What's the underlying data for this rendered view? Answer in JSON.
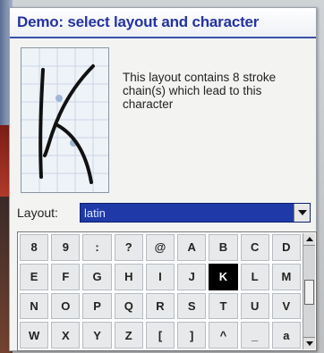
{
  "dialog": {
    "title": "Demo: select layout and character"
  },
  "preview": {
    "icon": "handwritten-character-preview",
    "character": "K"
  },
  "description": "This layout contains 8 stroke chain(s) which lead to this character",
  "layout": {
    "label": "Layout:",
    "value": "latin"
  },
  "grid": {
    "selected_character": "K",
    "rows": [
      [
        "8",
        "9",
        ":",
        "?",
        "@",
        "A",
        "B",
        "C",
        "D"
      ],
      [
        "E",
        "F",
        "G",
        "H",
        "I",
        "J",
        "K",
        "L",
        "M"
      ],
      [
        "N",
        "O",
        "P",
        "Q",
        "R",
        "S",
        "T",
        "U",
        "V"
      ],
      [
        "W",
        "X",
        "Y",
        "Z",
        "[",
        "]",
        "^",
        "_",
        "a"
      ]
    ]
  },
  "colors": {
    "title": "#2433a0",
    "selection": "#1f3aa8",
    "selected_cell": "#000000"
  }
}
